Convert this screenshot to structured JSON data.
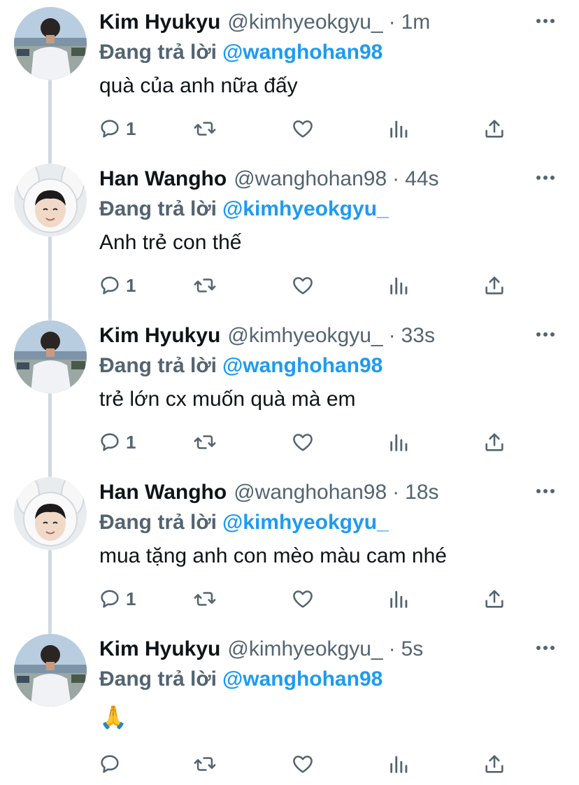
{
  "theme": {
    "text": "#0f1419",
    "muted": "#536471",
    "accent": "#1d9bf0",
    "thread_line": "#cfd9de"
  },
  "tweets": [
    {
      "author": "Kim Hyukyu",
      "handle": "@kimhyeokgyu_",
      "separator": "·",
      "time": "1m",
      "reply_prefix": "Đang trả lời",
      "reply_to": "@wanghohan98",
      "text": "quà của anh nữa đấy",
      "reply_count": "1",
      "avatar": "beach-portrait-avatar"
    },
    {
      "author": "Han Wangho",
      "handle": "@wanghohan98",
      "separator": "·",
      "time": "44s",
      "reply_prefix": "Đang trả lời",
      "reply_to": "@kimhyeokgyu_",
      "text": "Anh trẻ con thế",
      "reply_count": "1",
      "avatar": "bunny-hood-avatar"
    },
    {
      "author": "Kim Hyukyu",
      "handle": "@kimhyeokgyu_",
      "separator": "·",
      "time": "33s",
      "reply_prefix": "Đang trả lời",
      "reply_to": "@wanghohan98",
      "text": "trẻ lớn cx muốn quà mà em",
      "reply_count": "1",
      "avatar": "beach-portrait-avatar"
    },
    {
      "author": "Han Wangho",
      "handle": "@wanghohan98",
      "separator": "·",
      "time": "18s",
      "reply_prefix": "Đang trả lời",
      "reply_to": "@kimhyeokgyu_",
      "text": "mua tặng anh con mèo màu cam nhé",
      "reply_count": "1",
      "avatar": "bunny-hood-avatar"
    },
    {
      "author": "Kim Hyukyu",
      "handle": "@kimhyeokgyu_",
      "separator": "·",
      "time": "5s",
      "reply_prefix": "Đang trả lời",
      "reply_to": "@wanghohan98",
      "text": "🙏",
      "reply_count": "",
      "avatar": "beach-portrait-avatar"
    }
  ],
  "icons": {
    "reply": "reply-bubble-icon",
    "retweet": "retweet-icon",
    "like": "heart-icon",
    "views": "views-bars-icon",
    "share": "share-icon",
    "more": "more-dots-icon"
  }
}
